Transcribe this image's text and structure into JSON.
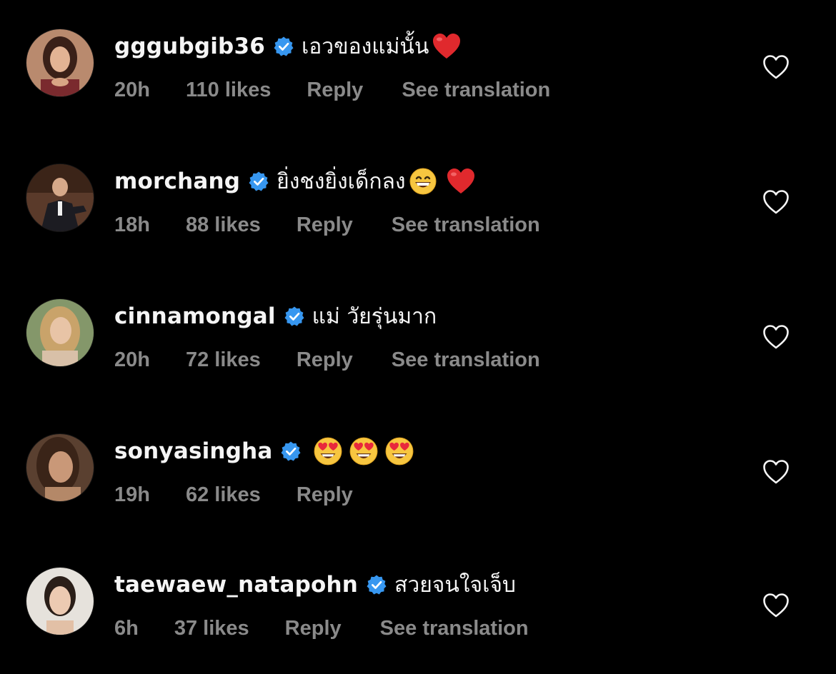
{
  "comments": [
    {
      "username": "gggubgib36",
      "text": "เอวของแม่นั้น",
      "emojis": [
        "red-heart"
      ],
      "time": "20h",
      "likes": "110 likes",
      "reply": "Reply",
      "translate": "See translation"
    },
    {
      "username": "morchang",
      "text": "ยิ่งชงยิ่งเด็กลง",
      "emojis": [
        "grinning-face",
        "red-heart"
      ],
      "time": "18h",
      "likes": "88 likes",
      "reply": "Reply",
      "translate": "See translation"
    },
    {
      "username": "cinnamongal",
      "text": "แม่ วัยรุ่นมาก",
      "emojis": [],
      "time": "20h",
      "likes": "72 likes",
      "reply": "Reply",
      "translate": "See translation"
    },
    {
      "username": "sonyasingha",
      "text": "",
      "emojis": [
        "heart-eyes-face",
        "heart-eyes-face",
        "heart-eyes-face"
      ],
      "time": "19h",
      "likes": "62 likes",
      "reply": "Reply",
      "translate": ""
    },
    {
      "username": "taewaew_natapohn",
      "text": "สวยจนใจเจ็บ",
      "emojis": [],
      "time": "6h",
      "likes": "37 likes",
      "reply": "Reply",
      "translate": "See translation"
    }
  ],
  "colors": {
    "background": "#000000",
    "primary_text": "#f5f5f5",
    "secondary_text": "#8a8a8a",
    "verified_badge": "#3797f0",
    "heart_outline": "#f5f5f5"
  }
}
